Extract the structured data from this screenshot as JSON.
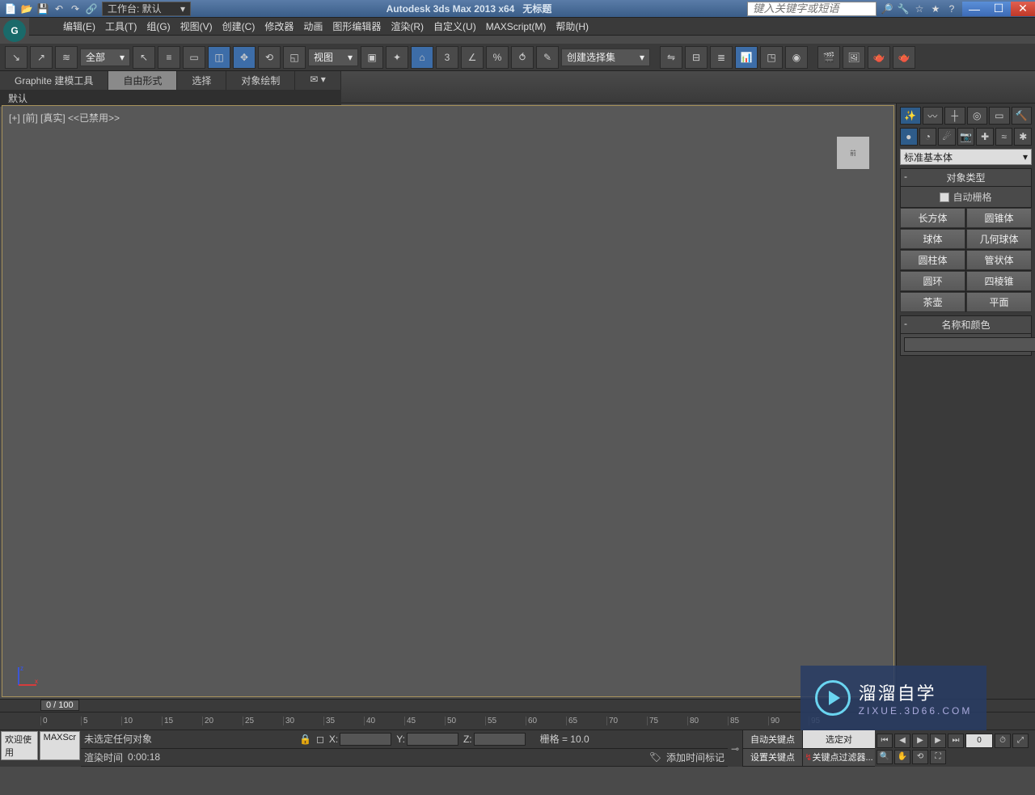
{
  "titlebar": {
    "workspace_label": "工作台: 默认",
    "app_title": "Autodesk 3ds Max  2013 x64",
    "doc_title": "无标题",
    "search_placeholder": "键入关键字或短语"
  },
  "menu": {
    "items": [
      "编辑(E)",
      "工具(T)",
      "组(G)",
      "视图(V)",
      "创建(C)",
      "修改器",
      "动画",
      "图形编辑器",
      "渲染(R)",
      "自定义(U)",
      "MAXScript(M)",
      "帮助(H)"
    ]
  },
  "toolbar": {
    "filter_all": "全部",
    "view_dd": "视图",
    "selset_dd": "创建选择集"
  },
  "ribbon": {
    "tabs": [
      "Graphite 建模工具",
      "自由形式",
      "选择",
      "对象绘制"
    ],
    "subtab": "默认"
  },
  "viewport": {
    "label": "[+] [前] [真实]  <<已禁用>>"
  },
  "cmdpanel": {
    "category_dd": "标准基本体",
    "section_objtype": "对象类型",
    "auto_grid": "自动栅格",
    "objects": [
      [
        "长方体",
        "圆锥体"
      ],
      [
        "球体",
        "几何球体"
      ],
      [
        "圆柱体",
        "管状体"
      ],
      [
        "圆环",
        "四棱锥"
      ],
      [
        "茶壶",
        "平面"
      ]
    ],
    "section_namecolor": "名称和颜色"
  },
  "timeline": {
    "cursor": "0 / 100",
    "ticks": [
      "0",
      "5",
      "10",
      "15",
      "20",
      "25",
      "30",
      "35",
      "40",
      "45",
      "50",
      "55",
      "60",
      "65",
      "70",
      "75",
      "80",
      "85",
      "90",
      "95"
    ]
  },
  "status": {
    "tab_welcome": "欢迎使用",
    "tab_maxscr": "MAXScr",
    "no_sel": "未选定任何对象",
    "render_time_lbl": "渲染时间",
    "render_time_val": "0:00:18",
    "x": "X:",
    "y": "Y:",
    "z": "Z:",
    "grid": "栅格 = 10.0",
    "add_time_marker": "添加时间标记",
    "auto_key": "自动关键点",
    "set_key": "设置关键点",
    "sel_lock": "选定对",
    "key_filter": "关键点过滤器...",
    "frame_num": "0"
  },
  "watermark": {
    "main": "溜溜自学",
    "sub": "ZIXUE.3D66.COM"
  }
}
